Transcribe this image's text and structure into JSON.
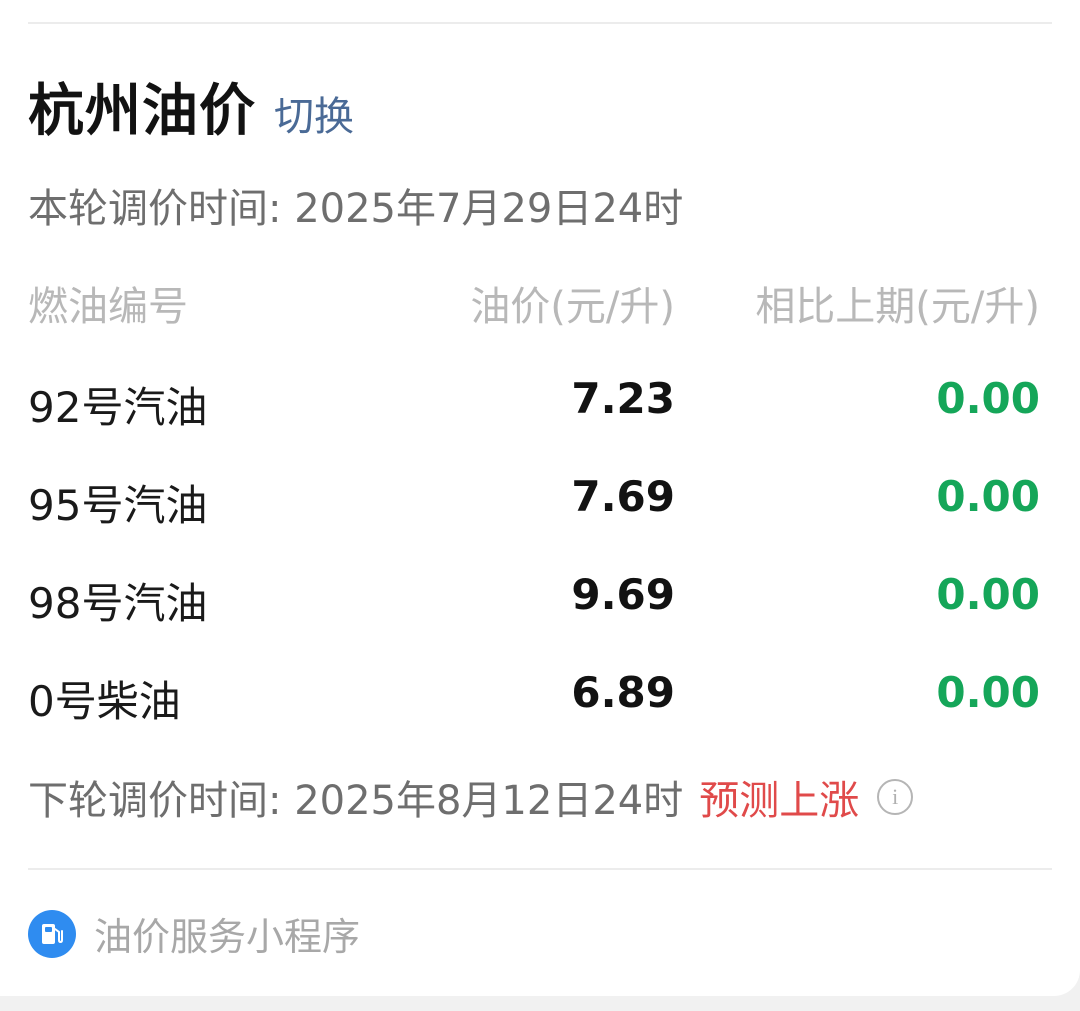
{
  "header": {
    "city_title": "杭州油价",
    "switch_label": "切换"
  },
  "current_adjust": {
    "text": "本轮调价时间: 2025年7月29日24时"
  },
  "columns": {
    "name": "燃油编号",
    "price": "油价(元/升)",
    "diff": "相比上期(元/升)"
  },
  "fuels": [
    {
      "name": "92号汽油",
      "price": "7.23",
      "diff": "0.00"
    },
    {
      "name": "95号汽油",
      "price": "7.69",
      "diff": "0.00"
    },
    {
      "name": "98号汽油",
      "price": "9.69",
      "diff": "0.00"
    },
    {
      "name": "0号柴油",
      "price": "6.89",
      "diff": "0.00"
    }
  ],
  "next_adjust": {
    "text": "下轮调价时间: 2025年8月12日24时",
    "forecast": "预测上涨",
    "info_icon": "info-icon"
  },
  "footer": {
    "icon": "fuel-pump-icon",
    "label": "油价服务小程序"
  },
  "colors": {
    "accent_link": "#4a6a96",
    "diff_green": "#15a659",
    "forecast_red": "#e04a4a",
    "badge_blue": "#2f8cf0"
  }
}
